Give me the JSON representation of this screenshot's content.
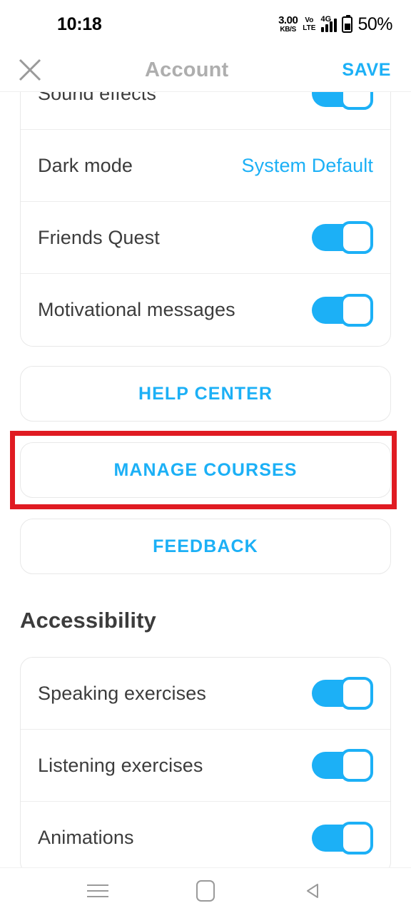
{
  "status_bar": {
    "time": "10:18",
    "net_speed_value": "3.00",
    "net_speed_unit": "KB/S",
    "volte_top": "Vo",
    "volte_bottom": "LTE",
    "network_type": "4G",
    "battery_percent": "50%",
    "signal_icon": "signal-bars-icon",
    "battery_icon": "battery-icon"
  },
  "app_bar": {
    "close_icon": "close-icon",
    "title": "Account",
    "save_label": "SAVE"
  },
  "settings": {
    "clipped_row": {
      "label": "Sound effects",
      "toggle": "on"
    },
    "rows": [
      {
        "label": "Dark mode",
        "value": "System Default",
        "control": "value"
      },
      {
        "label": "Friends Quest",
        "toggle": "on",
        "control": "toggle"
      },
      {
        "label": "Motivational messages",
        "toggle": "on",
        "control": "toggle"
      }
    ]
  },
  "buttons": [
    {
      "label": "HELP CENTER",
      "name": "help-center-button"
    },
    {
      "label": "MANAGE COURSES",
      "name": "manage-courses-button"
    },
    {
      "label": "FEEDBACK",
      "name": "feedback-button"
    }
  ],
  "accessibility": {
    "heading": "Accessibility",
    "rows": [
      {
        "label": "Speaking exercises",
        "toggle": "on"
      },
      {
        "label": "Listening exercises",
        "toggle": "on"
      },
      {
        "label": "Animations",
        "toggle": "on"
      }
    ]
  },
  "nav_bar": {
    "recents_icon": "recents-icon",
    "home_icon": "home-icon",
    "back_icon": "back-icon"
  },
  "annotation": {
    "target": "MANAGE COURSES",
    "color": "#e01b22"
  },
  "colors": {
    "accent_blue": "#1cb0f6",
    "text_dark": "#3c3c3c",
    "title_gray": "#aeaeae",
    "card_border": "#e8e8e8",
    "annotation_red": "#e01b22"
  }
}
